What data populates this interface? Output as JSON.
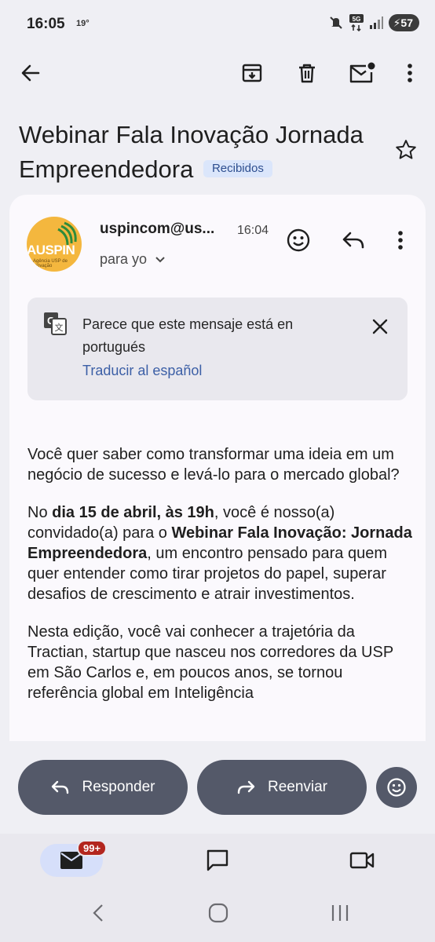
{
  "status_bar": {
    "time": "16:05",
    "temperature": "19°",
    "battery": "57",
    "icons": [
      "mute-icon",
      "5g-icon",
      "signal-icon",
      "battery-icon"
    ]
  },
  "toolbar": {
    "icons": [
      "back-arrow-icon",
      "archive-icon",
      "trash-icon",
      "mark-unread-icon",
      "more-vert-icon"
    ]
  },
  "email": {
    "subject": "Webinar Fala Inovação Jornada Empreendedora",
    "label": "Recibidos",
    "avatar_text": "AUSPIN",
    "avatar_subtext": "Agência USP de Inovação",
    "sender": "uspincom@us...",
    "time": "16:04",
    "recipient": "para yo"
  },
  "translation": {
    "message": "Parece que este mensaje está en portugués",
    "link": "Traducir al español"
  },
  "body": {
    "p1": "Você quer saber como transformar uma ideia em um negócio de sucesso e levá-lo para o mercado global?",
    "p2_a": "No ",
    "p2_b": "dia 15 de abril, às 19h",
    "p2_c": ", você é nosso(a) convidado(a) para o ",
    "p2_d": "Webinar Fala Inovação: Jornada Empreendedora",
    "p2_e": ", um encontro pensado para quem quer entender como tirar projetos do papel, superar desafios de crescimento e atrair investimentos.",
    "p3": "Nesta edição, você vai conhecer a trajetória da Tractian, startup que nasceu nos corredores da USP em São Carlos e, em poucos anos, se tornou referência global em Inteligência"
  },
  "actions": {
    "reply": "Responder",
    "forward": "Reenviar"
  },
  "bottom_nav": {
    "mail_badge": "99+"
  },
  "colors": {
    "accent": "#3c5fa6",
    "pill": "#545969",
    "badge": "#b3261e"
  }
}
